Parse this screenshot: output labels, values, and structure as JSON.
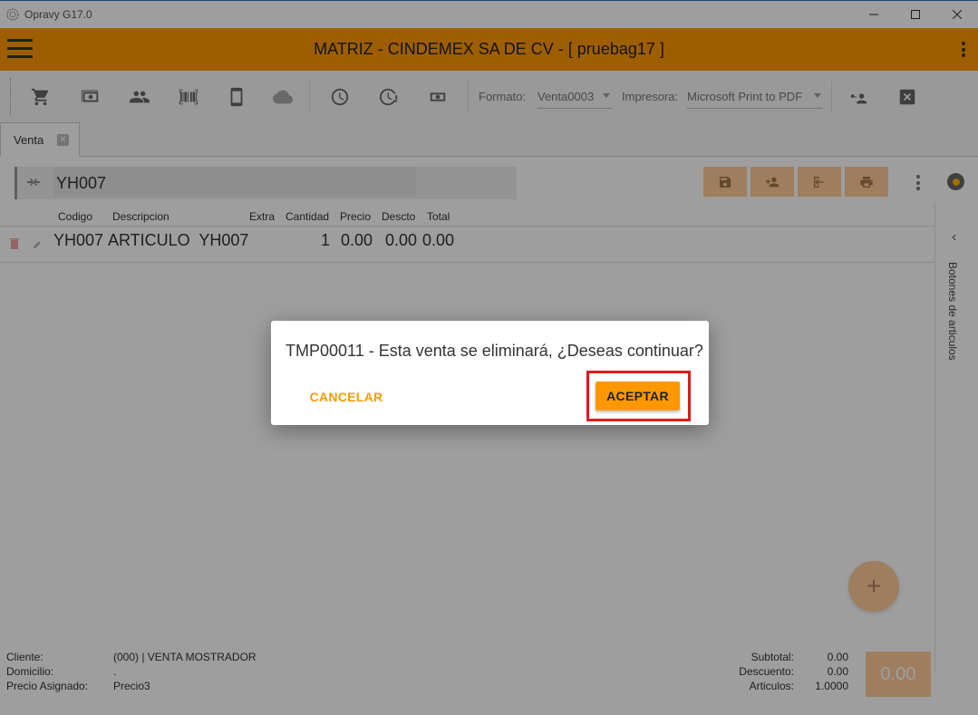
{
  "window": {
    "title": "Opravy G17.0",
    "controls": [
      "minimize-icon",
      "maximize-icon",
      "close-icon"
    ]
  },
  "header": {
    "title": "MATRIZ - CINDEMEX SA DE CV - [ pruebag17 ]",
    "accent_color": "#ff9800"
  },
  "toolbar": {
    "icons": [
      "cart-icon",
      "cash-icon",
      "people-icon",
      "barcode-icon",
      "tablet-icon",
      "cloud-icon",
      "clock-icon",
      "clock-alert-icon",
      "money-icon",
      "user-key-icon",
      "close-box-icon"
    ],
    "formato_label": "Formato:",
    "formato_value": "Venta0003",
    "impresora_label": "Impresora:",
    "impresora_value": "Microsoft Print to PDF"
  },
  "tabs": [
    {
      "label": "Venta"
    }
  ],
  "search": {
    "value": "YH007"
  },
  "table": {
    "columns": [
      "Codigo",
      "Descripcion",
      "Extra",
      "Cantidad",
      "Precio",
      "Descto",
      "Total"
    ],
    "rows": [
      {
        "codigo": "YH007",
        "descripcion": "ARTICULO  YH007",
        "extra": "",
        "cantidad": "1",
        "precio": "0.00",
        "descto": "0.00",
        "total": "0.00"
      }
    ]
  },
  "side_panel": {
    "label": "Botones de articulos"
  },
  "footer": {
    "cliente_label": "Cliente:",
    "cliente_value": "(000) | VENTA MOSTRADOR",
    "domicilio_label": "Domicilio:",
    "domicilio_value": ".",
    "precio_label": "Precio Asignado:",
    "precio_value": "Precio3",
    "subtotal_label": "Subtotal:",
    "subtotal_value": "0.00",
    "descuento_label": "Descuento:",
    "descuento_value": "0.00",
    "articulos_label": "Articulos:",
    "articulos_value": "1.0000",
    "total_value": "0.00"
  },
  "dialog": {
    "message": "TMP00011 - Esta venta se eliminará, ¿Deseas continuar?",
    "cancel_label": "CANCELAR",
    "accept_label": "ACEPTAR",
    "highlight_color": "#e01b1b"
  }
}
